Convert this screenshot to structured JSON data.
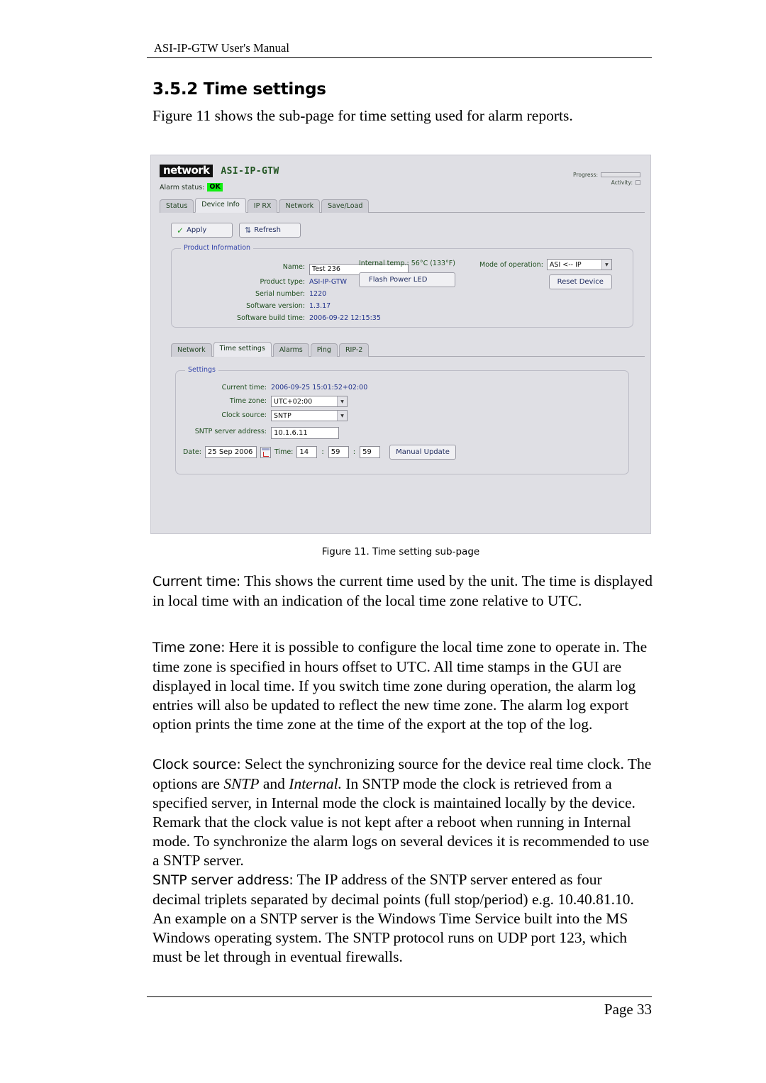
{
  "document": {
    "running_header": "ASI-IP-GTW User's Manual",
    "section_number_title": "3.5.2 Time settings",
    "intro": "Figure 11 shows the sub-page for time setting used for alarm reports.",
    "figure_caption": "Figure 11. Time setting sub-page",
    "page_footer": "Page 33"
  },
  "figure": {
    "app_header": {
      "logo_text": "network",
      "device_title": "ASI-IP-GTW",
      "alarm_status_label": "Alarm status:",
      "alarm_status_value": "OK",
      "alarm_status_color": "#10ee10",
      "progress_label": "Progress:",
      "activity_label": "Activity:"
    },
    "main_tabs": [
      {
        "label": "Status",
        "active": false
      },
      {
        "label": "Device Info",
        "active": true
      },
      {
        "label": "IP RX",
        "active": false
      },
      {
        "label": "Network",
        "active": false
      },
      {
        "label": "Save/Load",
        "active": false
      }
    ],
    "toolbar": {
      "apply_label": "Apply",
      "apply_icon": "check-icon",
      "refresh_label": "Refresh",
      "refresh_icon": "refresh-icon"
    },
    "product_information": {
      "legend": "Product Information",
      "name_label": "Name:",
      "name_value": "Test 236",
      "product_type_label": "Product type:",
      "product_type_value": "ASI-IP-GTW",
      "serial_number_label": "Serial number:",
      "serial_number_value": "1220",
      "software_version_label": "Software version:",
      "software_version_value": "1.3.17",
      "software_build_label": "Software build time:",
      "software_build_value": "2006-09-22 12:15:35",
      "internal_temp_text": "Internal temp.: 56°C (133°F)",
      "flash_power_led_label": "Flash Power LED",
      "mode_of_operation_label": "Mode of operation:",
      "mode_of_operation_value": "ASI <-- IP",
      "reset_device_label": "Reset Device"
    },
    "sub_tabs": [
      {
        "label": "Network",
        "active": false
      },
      {
        "label": "Time settings",
        "active": true
      },
      {
        "label": "Alarms",
        "active": false
      },
      {
        "label": "Ping",
        "active": false
      },
      {
        "label": "RIP-2",
        "active": false
      }
    ],
    "settings": {
      "legend": "Settings",
      "current_time_label": "Current time:",
      "current_time_value": "2006-09-25 15:01:52+02:00",
      "time_zone_label": "Time zone:",
      "time_zone_value": "UTC+02:00",
      "clock_source_label": "Clock source:",
      "clock_source_value": "SNTP",
      "sntp_server_label": "SNTP server address:",
      "sntp_server_value": "10.1.6.11",
      "date_label": "Date:",
      "date_value": "25 Sep 2006",
      "calendar_icon": "calendar-icon",
      "time_label": "Time:",
      "time_hours": "14",
      "time_minutes": "59",
      "time_seconds": "59",
      "separator": ":",
      "manual_update_label": "Manual Update"
    }
  },
  "body": {
    "current_time": {
      "term": "Current time:",
      "text": " This shows the current time used by the unit. The time is displayed in local time with an indication of the local time zone relative to UTC."
    },
    "time_zone": {
      "term": "Time zone:",
      "text": " Here it is possible to configure the local time zone to operate in. The time zone is specified in hours offset to UTC. All time stamps in the GUI are displayed in local time. If you switch time zone during operation, the alarm log entries will also be updated to reflect the new time zone. The alarm log export option prints the time zone at the time of the export at the top of the log."
    },
    "clock_source": {
      "term": "Clock source:",
      "text_a": " Select the synchronizing source for the device real time clock. The options are ",
      "italic_a": "SNTP",
      "text_b": " and ",
      "italic_b": "Internal.",
      "text_c": " In SNTP mode the clock is retrieved from a specified server, in Internal mode the clock is maintained locally by the device. Remark that the clock value is not kept after a reboot when running in Internal mode. To synchronize the alarm logs on several devices it is recommended to use a SNTP server."
    },
    "sntp_server_address": {
      "term": "SNTP server address:",
      "text": " The IP address of the SNTP server entered as four decimal triplets separated by decimal points (full stop/period) e.g. 10.40.81.10. An example on a SNTP server is the Windows Time Service built into the MS Windows operating system. The SNTP protocol runs on UDP port 123, which must be let through in eventual firewalls."
    }
  }
}
